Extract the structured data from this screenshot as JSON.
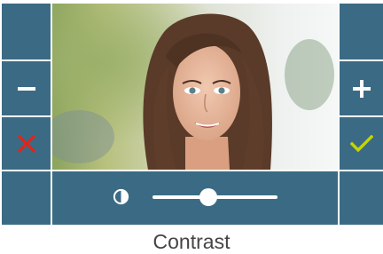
{
  "screen": {
    "caption": "Contrast"
  },
  "left_controls": [
    {
      "icon": "blank"
    },
    {
      "icon": "minus-icon"
    },
    {
      "icon": "close-icon"
    },
    {
      "icon": "blank"
    }
  ],
  "right_controls": [
    {
      "icon": "blank"
    },
    {
      "icon": "plus-icon"
    },
    {
      "icon": "checkmark-icon"
    },
    {
      "icon": "blank"
    }
  ],
  "contrast_slider": {
    "icon": "contrast-icon",
    "value": 0.45
  },
  "colors": {
    "panel": "#3b6b84",
    "icon_white": "#ffffff",
    "cancel_red": "#e0251c",
    "confirm_yellow_green": "#c4d600",
    "caption_text": "#444444"
  }
}
